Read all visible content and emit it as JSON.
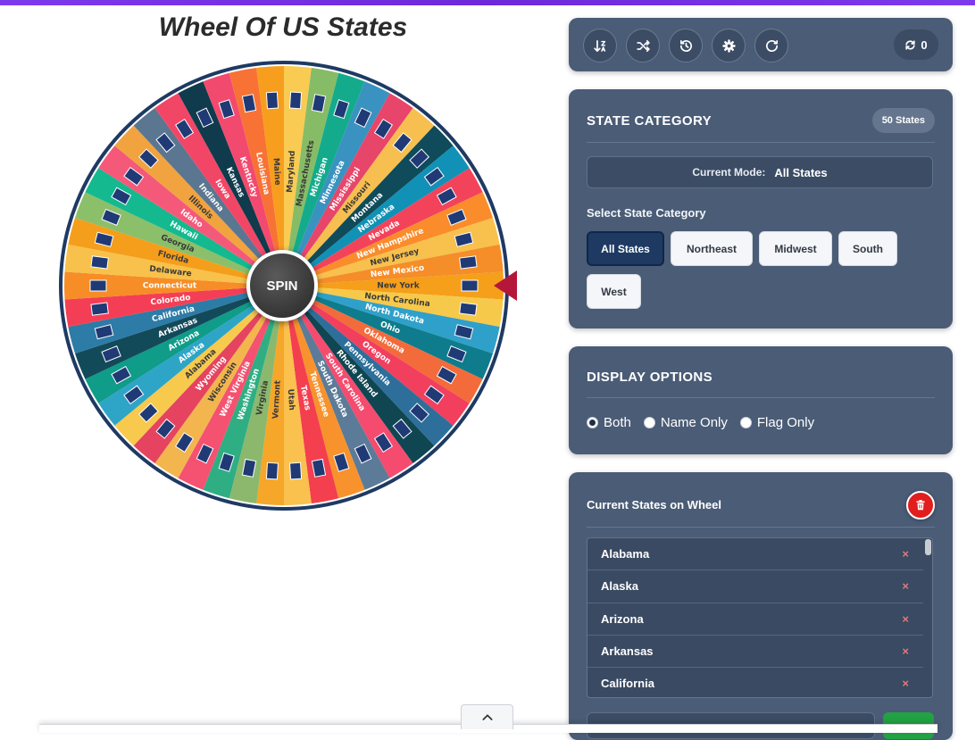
{
  "page": {
    "title": "Wheel Of US States"
  },
  "wheel": {
    "spin_label": "SPIN",
    "segments": [
      "New York",
      "North Carolina",
      "North Dakota",
      "Ohio",
      "Oklahoma",
      "Oregon",
      "Pennsylvania",
      "Rhode Island",
      "South Carolina",
      "South Dakota",
      "Tennessee",
      "Texas",
      "Utah",
      "Vermont",
      "Virginia",
      "Washington",
      "West Virginia",
      "Wisconsin",
      "Wyoming",
      "Alabama",
      "Alaska",
      "Arizona",
      "Arkansas",
      "California",
      "Colorado",
      "Connecticut",
      "Delaware",
      "Florida",
      "Georgia",
      "Hawaii",
      "Idaho",
      "Illinois",
      "Indiana",
      "Iowa",
      "Kansas",
      "Kentucky",
      "Louisiana",
      "Maine",
      "Maryland",
      "Massachusetts",
      "Michigan",
      "Minnesota",
      "Mississippi",
      "Missouri",
      "Montana",
      "Nebraska",
      "Nevada",
      "New Hampshire",
      "New Jersey",
      "New Mexico"
    ],
    "colors": [
      "#f59f1a",
      "#f6c94a",
      "#2fa0c9",
      "#0e7c8c",
      "#f36b3a",
      "#f23f5e",
      "#2d6f9a",
      "#0f4651",
      "#f44b6e",
      "#5b7b98",
      "#f8922c",
      "#f43f4f",
      "#fac14e",
      "#f6a628",
      "#8bb86d",
      "#2fae83",
      "#f55170",
      "#f3b54d",
      "#e5435f",
      "#f7c94d",
      "#2ea5c6",
      "#0f9c89",
      "#134a5a",
      "#2d7ba7",
      "#f43e55",
      "#f78d26",
      "#f7c14b",
      "#f59e1b",
      "#8bbf6a",
      "#14b98f",
      "#f5597a",
      "#f1a33f",
      "#5a7691",
      "#f24667",
      "#0f3b4c",
      "#f24a6e",
      "#f87235",
      "#f89e1e",
      "#facb52",
      "#87bc67",
      "#14ab8c",
      "#3a92c0",
      "#e8456a",
      "#f6bf50",
      "#0f4b5a",
      "#1191b5",
      "#f3435a",
      "#fa8c2b",
      "#f8c04d",
      "#f58d29"
    ],
    "rim_color": "#1e3a63"
  },
  "toolbar": {
    "buttons": [
      {
        "name": "sort-button",
        "icon": "sort-icon"
      },
      {
        "name": "shuffle-button",
        "icon": "shuffle-icon"
      },
      {
        "name": "history-button",
        "icon": "history-icon"
      },
      {
        "name": "settings-button",
        "icon": "gear-icon"
      },
      {
        "name": "reset-button",
        "icon": "redo-icon"
      }
    ],
    "spin_count": "0"
  },
  "category": {
    "heading": "STATE CATEGORY",
    "badge": "50 States",
    "mode_label": "Current Mode:",
    "mode_value": "All States",
    "select_label": "Select State Category",
    "options": [
      "All States",
      "Northeast",
      "Midwest",
      "South",
      "West"
    ],
    "active": "All States"
  },
  "display": {
    "heading": "DISPLAY OPTIONS",
    "options": [
      "Both",
      "Name Only",
      "Flag Only"
    ],
    "selected": "Both"
  },
  "list": {
    "heading": "Current States on Wheel",
    "items": [
      "Alabama",
      "Alaska",
      "Arizona",
      "Arkansas",
      "California"
    ],
    "remove_glyph": "×"
  },
  "colors": {
    "panel": "#4a5c76",
    "accent": "#1e3a63",
    "danger": "#e11d1d",
    "success": "#22a243",
    "pointer": "#b5173a"
  }
}
